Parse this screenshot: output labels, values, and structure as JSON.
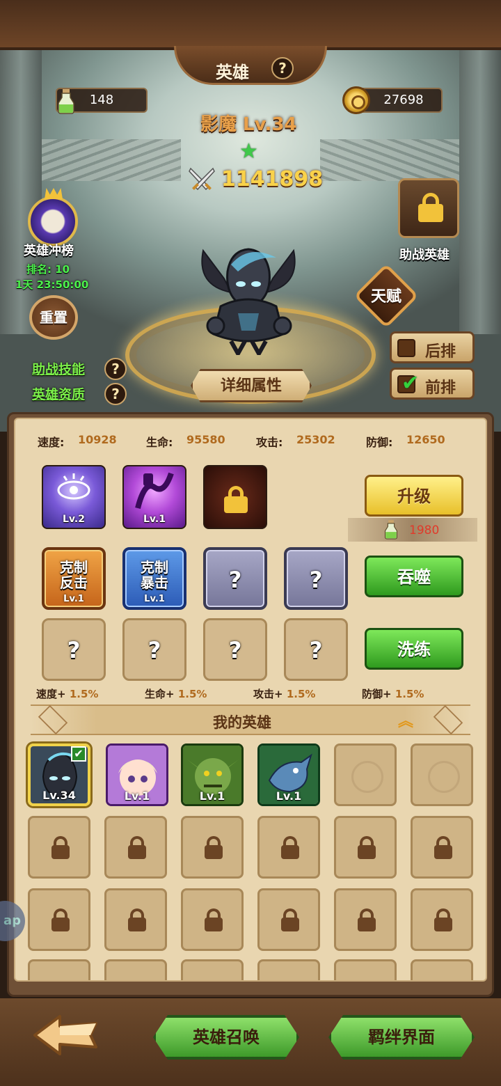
{
  "header": {
    "title": "英雄",
    "help_glyph": "?",
    "potion_count": "148",
    "gold_count": "27698"
  },
  "hero": {
    "name": "影魔 Lv.34",
    "stars": 1,
    "power": "1141898"
  },
  "left_panel": {
    "rank_title": "英雄冲榜",
    "rank_line": "排名: 10",
    "timer": "1天 23:50:00",
    "reset_label": "重置",
    "assist_skill_link": "助战技能",
    "aptitude_link": "英雄资质"
  },
  "right_panel": {
    "assist_hero_label": "助战英雄",
    "talent_label": "天赋",
    "back_row_label": "后排",
    "front_row_label": "前排",
    "front_row_checked": true
  },
  "detail_button": "详细属性",
  "stats": [
    {
      "label": "速度:",
      "value": "10928"
    },
    {
      "label": "生命:",
      "value": "95580"
    },
    {
      "label": "攻击:",
      "value": "25302"
    },
    {
      "label": "防御:",
      "value": "12650"
    }
  ],
  "skills": [
    {
      "lv": "Lv.2",
      "icon": "eye-rune-icon",
      "color": "#6a52c8"
    },
    {
      "lv": "Lv.1",
      "icon": "shadow-wave-icon",
      "color": "#9a3ad0"
    },
    {
      "lv": "",
      "icon": "locked-skill-icon",
      "color": "#3a1a10"
    }
  ],
  "runes_row1": [
    {
      "text": "克制\n反击",
      "lv": "Lv.1",
      "style": "orange"
    },
    {
      "text": "克制\n暴击",
      "lv": "Lv.1",
      "style": "blue"
    },
    {
      "text": "?",
      "lv": "",
      "style": "gray"
    },
    {
      "text": "?",
      "lv": "",
      "style": "gray"
    }
  ],
  "runes_row2": [
    "?",
    "?",
    "?",
    "?"
  ],
  "actions": {
    "upgrade": "升级",
    "upgrade_cost": "1980",
    "devour": "吞噬",
    "refine": "洗练"
  },
  "bonuses": [
    {
      "label": "速度+",
      "value": "1.5%"
    },
    {
      "label": "生命+",
      "value": "1.5%"
    },
    {
      "label": "攻击+",
      "value": "1.5%"
    },
    {
      "label": "防御+",
      "value": "1.5%"
    }
  ],
  "my_heroes": {
    "title": "我的英雄",
    "cards": [
      {
        "lv": "Lv.34",
        "selected": true,
        "color": "#3a4a5a"
      },
      {
        "lv": "Lv.1",
        "selected": false,
        "color": "#b47ad8"
      },
      {
        "lv": "Lv.1",
        "selected": false,
        "color": "#4a7a2a"
      },
      {
        "lv": "Lv.1",
        "selected": false,
        "color": "#2a6a3a"
      }
    ]
  },
  "bottom_nav": {
    "summon": "英雄召唤",
    "bond": "羁绊界面"
  },
  "side_tab": "ap"
}
